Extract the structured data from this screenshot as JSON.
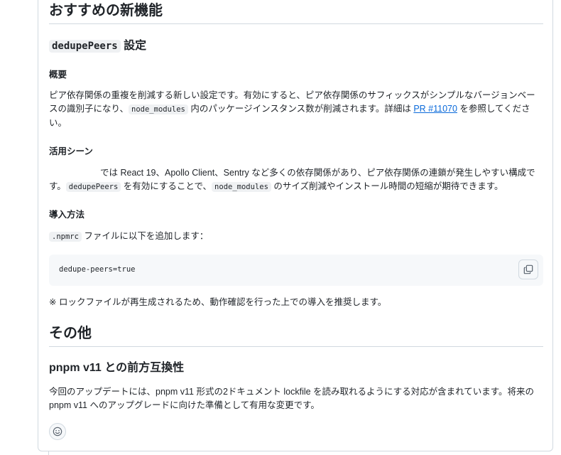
{
  "section_main": {
    "title": "おすすめの新機能"
  },
  "feature": {
    "title_code": "dedupePeers",
    "title_suffix": " 設定",
    "overview_heading": "概要",
    "overview_text_1": "ピア依存関係の重複を削減する新しい設定です。有効にすると、ピア依存関係のサフィックスがシンプルなバージョンベースの識別子になり、",
    "overview_code": "node_modules",
    "overview_text_2": " 内のパッケージインスタンス数が削減されます。詳細は ",
    "overview_link": "PR #11070",
    "overview_text_3": " を参照してください。",
    "usecase_heading": "活用シーン",
    "usecase_text_1": "では React 19、Apollo Client、Sentry など多くの依存関係があり、ピア依存関係の連鎖が発生しやすい構成です。",
    "usecase_code_1": "dedupePeers",
    "usecase_text_2": " を有効にすることで、",
    "usecase_code_2": "node_modules",
    "usecase_text_3": " のサイズ削減やインストール時間の短縮が期待できます。",
    "install_heading": "導入方法",
    "install_code": ".npmrc",
    "install_text": " ファイルに以下を追加します：",
    "code_block": "dedupe-peers=true",
    "note": "※ ロックファイルが再生成されるため、動作確認を行った上での導入を推奨します。"
  },
  "section_other": {
    "title": "その他",
    "subtitle": "pnpm v11 との前方互換性",
    "text": "今回のアップデートには、pnpm v11 形式の2ドキュメント lockfile を読み取れるようにする対応が含まれています。将来の pnpm v11 へのアップグレードに向けた準備として有用な変更です。"
  },
  "icons": {
    "copy": "copy-icon",
    "reaction": "smiley-icon"
  }
}
